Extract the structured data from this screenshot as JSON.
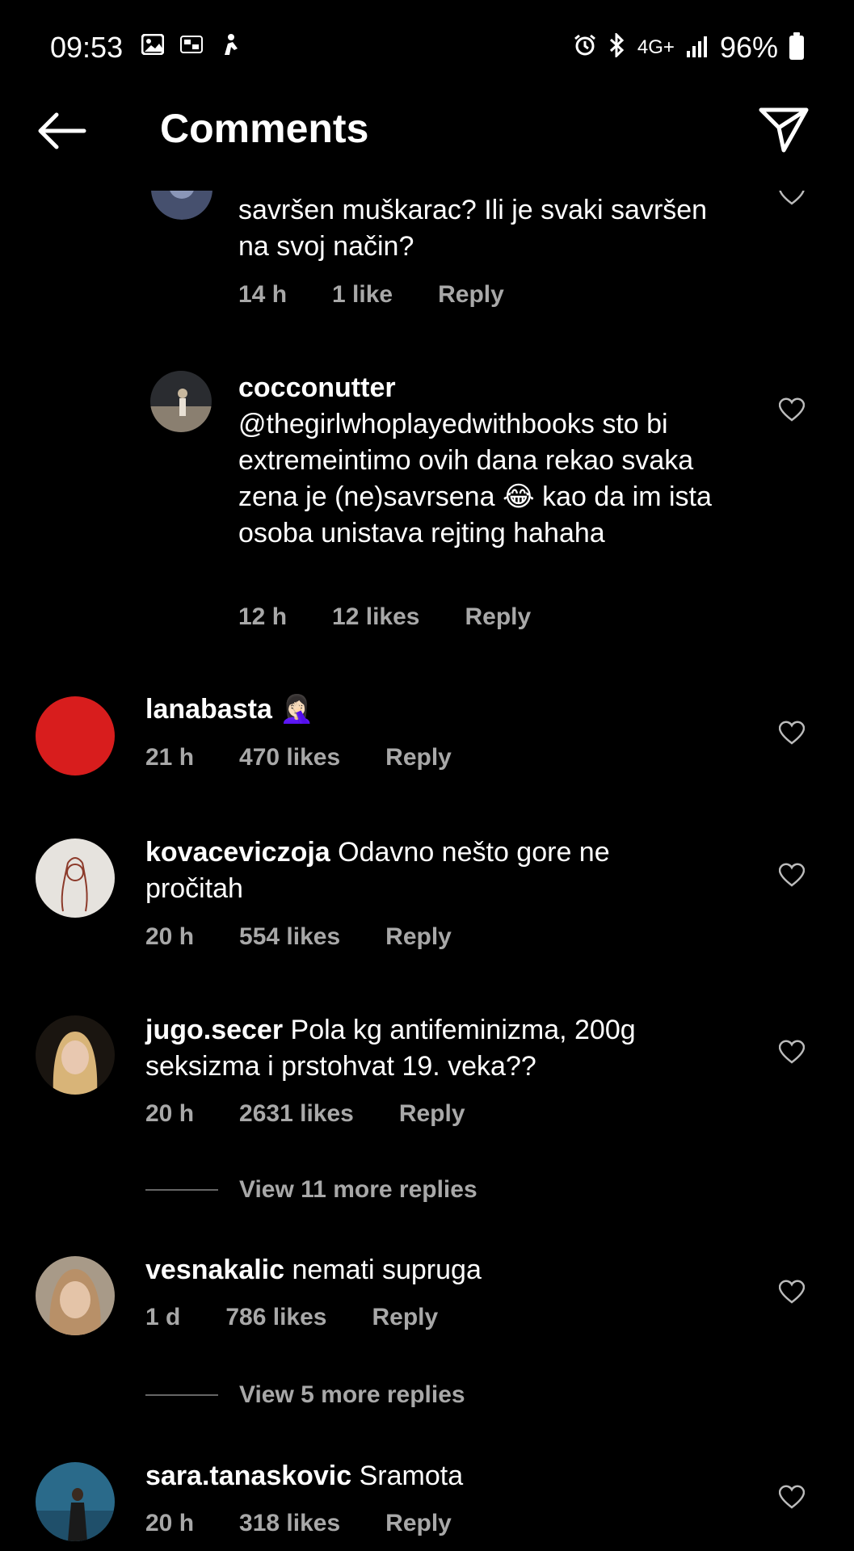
{
  "status_bar": {
    "time": "09:53",
    "network": "4G+",
    "battery": "96%",
    "left_icons": [
      "gallery-icon",
      "page-six-icon",
      "app-notification-icon"
    ],
    "right_icons": [
      "alarm-icon",
      "bluetooth-icon",
      "network-icon",
      "signal-icon",
      "battery-icon"
    ]
  },
  "header": {
    "title": "Comments"
  },
  "comments": [
    {
      "username": "",
      "text": "savršen muškarac? Ili je svaki savršen na svoj način?",
      "time": "14 h",
      "likes": "1 like",
      "reply": "Reply"
    },
    {
      "username": "cocconutter",
      "text": "@thegirlwhoplayedwithbooks sto bi extremeintimo ovih dana rekao svaka zena je (ne)savrsena 😂 kao da im ista osoba unistava rejting hahaha",
      "time": "12 h",
      "likes": "12 likes",
      "reply": "Reply"
    },
    {
      "username": "lanabasta",
      "text": "🤦🏻‍♀️",
      "time": "21 h",
      "likes": "470 likes",
      "reply": "Reply"
    },
    {
      "username": "kovaceviczoja",
      "text": "Odavno nešto gore ne pročitah",
      "time": "20 h",
      "likes": "554 likes",
      "reply": "Reply"
    },
    {
      "username": "jugo.secer",
      "text": "Pola kg antifeminizma, 200g seksizma i prstohvat 19. veka??",
      "time": "20 h",
      "likes": "2631 likes",
      "reply": "Reply",
      "view_more": "View 11 more replies"
    },
    {
      "username": "vesnakalic",
      "text": "nemati supruga",
      "time": "1 d",
      "likes": "786 likes",
      "reply": "Reply",
      "view_more": "View 5 more replies"
    },
    {
      "username": "sara.tanaskovic",
      "text": "Sramota",
      "time": "20 h",
      "likes": "318 likes",
      "reply": "Reply"
    }
  ]
}
